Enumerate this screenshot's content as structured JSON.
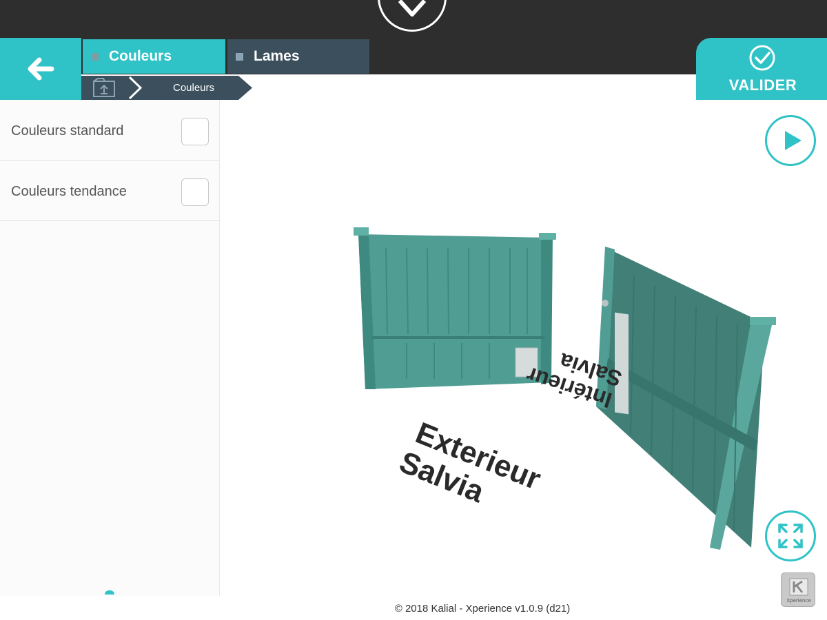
{
  "header": {
    "back_icon": "arrow-left-icon",
    "logo_icon": "diamond-logo-icon"
  },
  "tabs": [
    {
      "label": "Couleurs",
      "active": true,
      "color": "#2fc2c6"
    },
    {
      "label": "Lames",
      "active": false,
      "color": "#3b4f5c"
    }
  ],
  "breadcrumb": {
    "home_icon": "folder-up-icon",
    "current": "Couleurs"
  },
  "validate": {
    "label": "VALIDER",
    "icon": "check-circle-icon"
  },
  "sidebar": {
    "options": [
      {
        "label": "Couleurs standard",
        "checked": false
      },
      {
        "label": "Couleurs tendance",
        "checked": false
      }
    ]
  },
  "viewer": {
    "gate_color": "#4f9d93",
    "exterior_text": [
      "Exterieur",
      "Salvia"
    ],
    "interior_text": [
      "Intérieur",
      "Salvia"
    ],
    "play_icon": "play-icon",
    "fullscreen_icon": "expand-icon",
    "brand_icon": "k-logo-icon",
    "brand_text": "Xperience"
  },
  "footer": {
    "copyright": "© 2018 Kalial - Xperience v1.0.9 (d21)"
  },
  "colors": {
    "accent": "#2fc2c6",
    "dark": "#2e2e2e",
    "slate": "#3b4f5c"
  }
}
